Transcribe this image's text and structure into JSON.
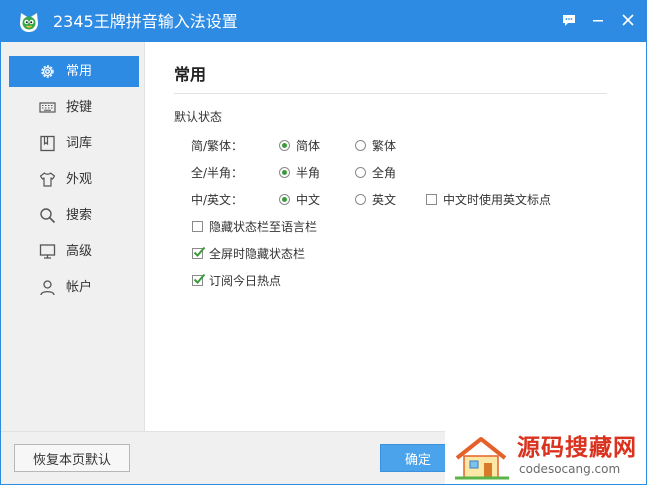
{
  "window": {
    "title": "2345王牌拼音输入法设置"
  },
  "sidebar": {
    "items": [
      {
        "label": "常用",
        "icon": "gear-icon",
        "active": true
      },
      {
        "label": "按键",
        "icon": "keyboard-icon",
        "active": false
      },
      {
        "label": "词库",
        "icon": "book-icon",
        "active": false
      },
      {
        "label": "外观",
        "icon": "shirt-icon",
        "active": false
      },
      {
        "label": "搜索",
        "icon": "search-icon",
        "active": false
      },
      {
        "label": "高级",
        "icon": "monitor-icon",
        "active": false
      },
      {
        "label": "帐户",
        "icon": "user-icon",
        "active": false
      }
    ]
  },
  "main": {
    "page_title": "常用",
    "section_title": "默认状态",
    "rows": [
      {
        "label": "简/繁体：",
        "options": [
          {
            "label": "简体",
            "selected": true
          },
          {
            "label": "繁体",
            "selected": false
          }
        ]
      },
      {
        "label": "全/半角：",
        "options": [
          {
            "label": "半角",
            "selected": true
          },
          {
            "label": "全角",
            "selected": false
          }
        ]
      },
      {
        "label": "中/英文：",
        "options": [
          {
            "label": "中文",
            "selected": true
          },
          {
            "label": "英文",
            "selected": false
          }
        ],
        "extra_checkbox": {
          "label": "中文时使用英文标点",
          "checked": false
        }
      }
    ],
    "checkboxes": [
      {
        "label": "隐藏状态栏至语言栏",
        "checked": false
      },
      {
        "label": "全屏时隐藏状态栏",
        "checked": true
      },
      {
        "label": "订阅今日热点",
        "checked": true
      }
    ]
  },
  "footer": {
    "restore_label": "恢复本页默认",
    "ok_label": "确定"
  },
  "watermark": {
    "title": "源码搜藏网",
    "url": "codesocang.com"
  },
  "colors": {
    "accent": "#2d8be3",
    "check": "#3b9b3b",
    "watermark_red": "#d9331f"
  }
}
